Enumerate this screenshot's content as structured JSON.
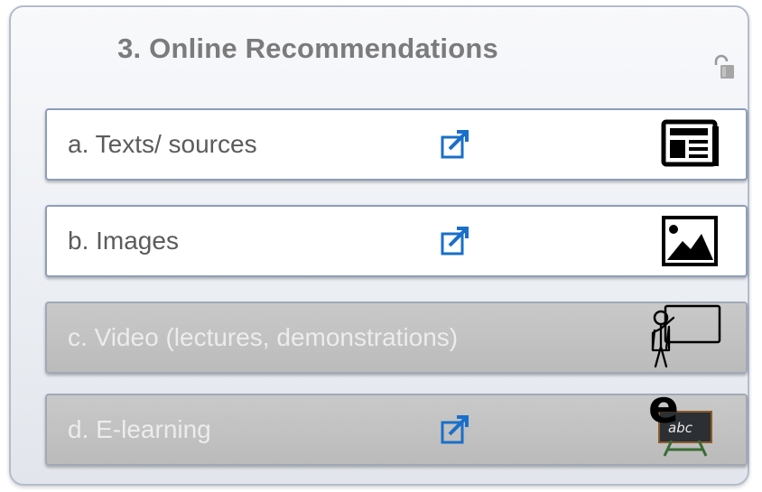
{
  "panel": {
    "title": "3. Online Recommendations",
    "lock_icon": "unlocked-padlock-icon"
  },
  "items": [
    {
      "label": "a. Texts/ sources",
      "state": "active",
      "has_link": true,
      "link_icon": "open-external-icon",
      "type_icon": "newspaper-icon"
    },
    {
      "label": "b. Images",
      "state": "active",
      "has_link": true,
      "link_icon": "open-external-icon",
      "type_icon": "image-icon"
    },
    {
      "label": "c. Video (lectures, demonstrations)",
      "state": "inactive",
      "has_link": false,
      "type_icon": "presenter-at-board-icon"
    },
    {
      "label": "d. E-learning",
      "state": "inactive",
      "has_link": true,
      "link_icon": "open-external-icon",
      "type_icon": "e-learning-chalkboard-icon"
    }
  ],
  "colors": {
    "link_blue": "#1a6fc9",
    "active_text": "#5b5b5b",
    "inactive_text": "#ececec",
    "title_text": "#7b7b7b"
  }
}
